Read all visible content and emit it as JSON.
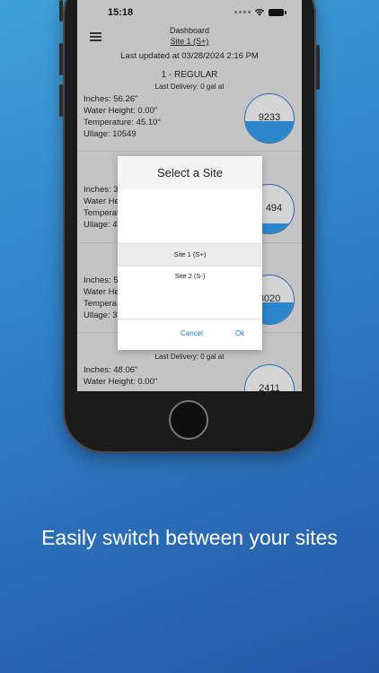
{
  "status_bar": {
    "time": "15:18"
  },
  "header": {
    "title": "Dashboard",
    "site": "Site 1 (S+)",
    "last_updated": "Last updated at 03/28/2024 2:16 PM"
  },
  "tanks": [
    {
      "title": "1 - REGULAR",
      "delivery": "Last Delivery: 0 gal at",
      "inches": "Inches: 56.26\"",
      "water": "Water Height: 0.00\"",
      "temperature": "Temperature: 45.10°",
      "ullage": "Ullage: 10549",
      "gauge_value": "9233",
      "fill_fraction": 0.45
    },
    {
      "inches": "Inches: 3",
      "water": "Water He",
      "temperature": "Temperat",
      "ullage": "Ullage: 4",
      "gauge_value": "494",
      "fill_fraction": 0.2
    },
    {
      "inches": "Inches: 5",
      "water": "Water He",
      "temperature": "Tempera",
      "ullage": "Ullage: 3",
      "gauge_value": "8020",
      "fill_fraction": 0.45
    },
    {
      "delivery": "Last Delivery: 0 gal at",
      "inches": "Inches: 48.06\"",
      "water": "Water Height: 0.00\"",
      "gauge_value": "2411"
    }
  ],
  "dialog": {
    "title": "Select a Site",
    "options": [
      "Site 1 (S+)",
      "Site 2 (S-)"
    ],
    "selected": "Site 1 (S+)",
    "cancel_label": "Cancel",
    "ok_label": "Ok"
  },
  "caption": "Easily switch between your sites",
  "colors": {
    "accent": "#1f7ae0",
    "gauge_fill": "#2c86cc",
    "gauge_border": "#2a6fb8"
  }
}
